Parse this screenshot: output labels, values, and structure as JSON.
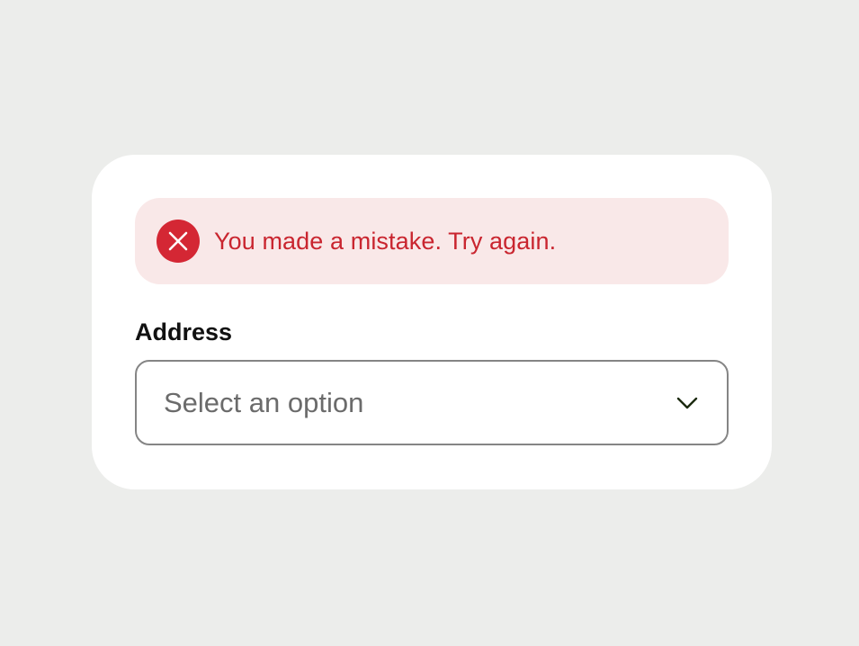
{
  "alert": {
    "message": "You made a mistake. Try again.",
    "icon": "error-x-icon",
    "color": "#d42734",
    "background": "#f9e8e8"
  },
  "address_field": {
    "label": "Address",
    "placeholder": "Select an option",
    "icon": "chevron-down-icon"
  }
}
